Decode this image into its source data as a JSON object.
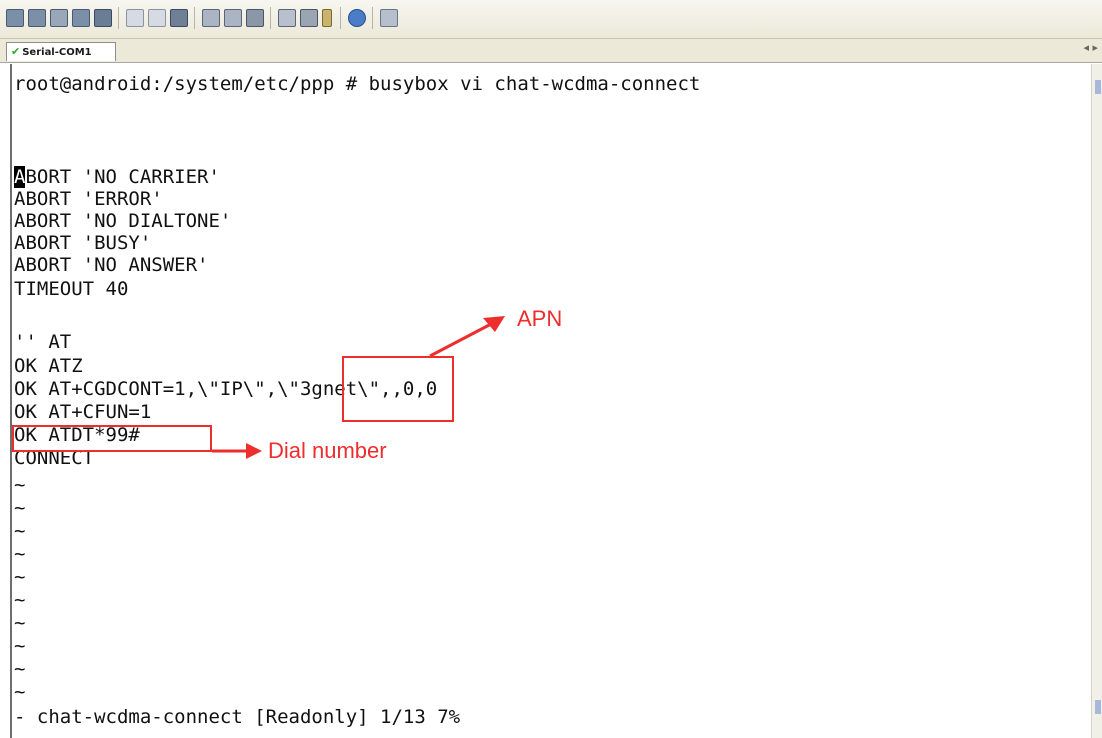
{
  "toolbar": {
    "icons": [
      "connect-icon",
      "reconnect-icon",
      "disconnect-icon",
      "connect-all-icon",
      "close-session-icon",
      "copy-icon",
      "paste-icon",
      "find-icon",
      "print-icon",
      "print-setup-icon",
      "print-screen-icon",
      "session-options-icon",
      "settings-icon",
      "key-icon",
      "help-icon",
      "extra-icon"
    ]
  },
  "tab": {
    "label": "Serial-COM1",
    "status_icon": "check-icon"
  },
  "terminal": {
    "prompt_line": "root@android:/system/etc/ppp # busybox vi chat-wcdma-connect",
    "cursor_char": "A",
    "lines": [
      "BORT 'NO CARRIER'",
      "ABORT 'ERROR'",
      "ABORT 'NO DIALTONE'",
      "ABORT 'BUSY'",
      "ABORT 'NO ANSWER'",
      "TIMEOUT 40",
      "",
      "'' AT",
      "OK ATZ",
      "OK AT+CGDCONT=1,\\\"IP\\\",\\\"3gnet\\\",,0,0",
      "OK AT+CFUN=1",
      "OK ATDT*99#",
      "CONNECT"
    ],
    "tildes": [
      "~",
      "~",
      "~",
      "~",
      "~",
      "~",
      "~",
      "~",
      "~",
      "~",
      "~"
    ],
    "status_line": "- chat-wcdma-connect [Readonly] 1/13 7%"
  },
  "annotations": {
    "apn_label": "APN",
    "dial_label": "Dial number",
    "color": "#ee2d2d"
  },
  "colors": {
    "annotation": "#ee2d2d",
    "tab_check": "#2fa82a"
  }
}
